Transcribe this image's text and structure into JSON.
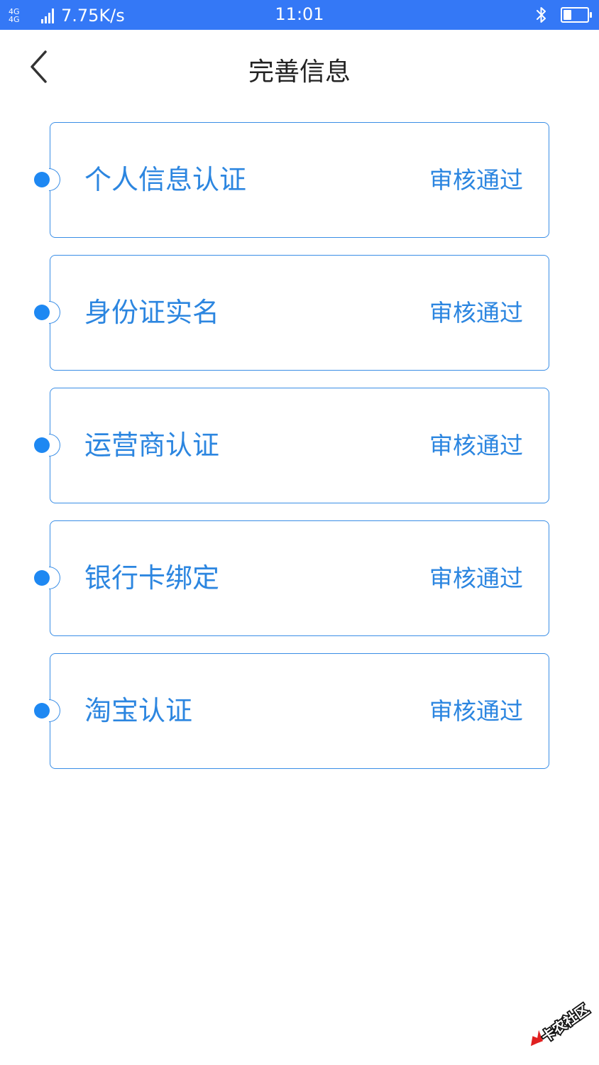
{
  "status_bar": {
    "network_top": "4G",
    "network_bottom": "4G",
    "speed": "7.75K/s",
    "time": "11:01",
    "battery_level": 0.35
  },
  "header": {
    "title": "完善信息"
  },
  "items": [
    {
      "label": "个人信息认证",
      "status": "审核通过"
    },
    {
      "label": "身份证实名",
      "status": "审核通过"
    },
    {
      "label": "运营商认证",
      "status": "审核通过"
    },
    {
      "label": "银行卡绑定",
      "status": "审核通过"
    },
    {
      "label": "淘宝认证",
      "status": "审核通过"
    }
  ],
  "watermark": {
    "text": "卡农社区"
  },
  "colors": {
    "status_bar": "#3478f6",
    "accent": "#2c86e0",
    "title": "#222222"
  },
  "icons": {
    "back": "chevron-left-icon",
    "bluetooth": "bluetooth-icon",
    "battery": "battery-icon",
    "signal": "signal-icon"
  }
}
